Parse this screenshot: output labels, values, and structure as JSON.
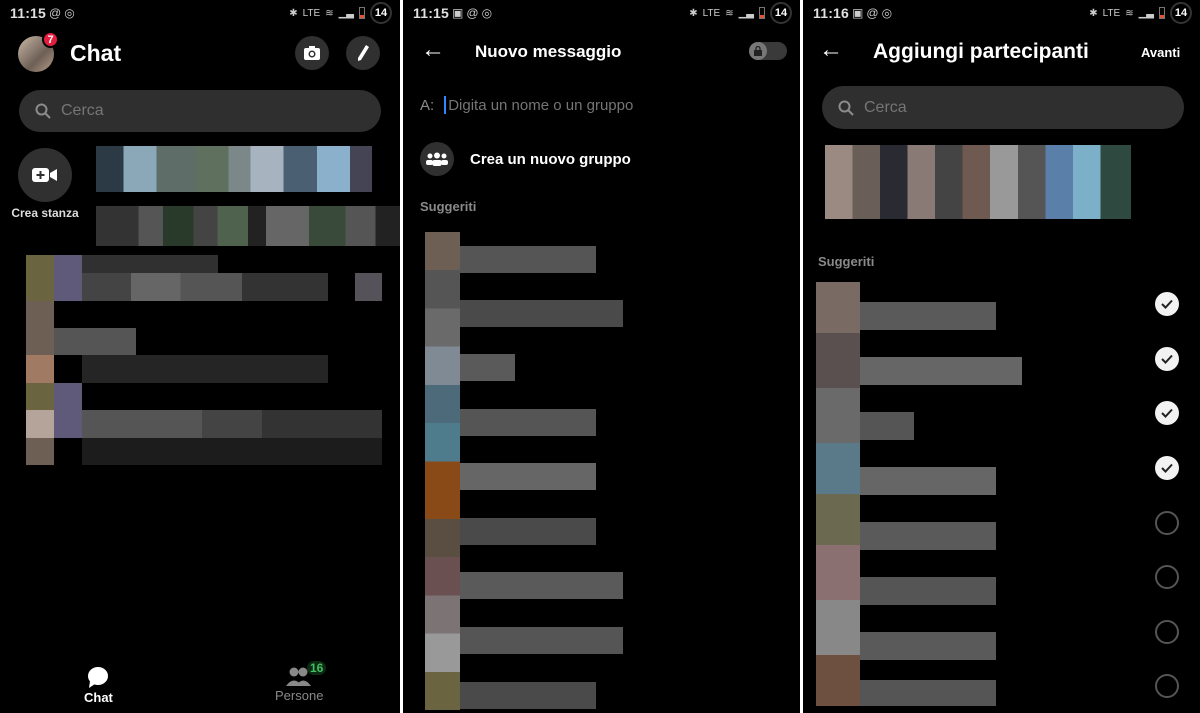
{
  "screens": [
    {
      "status": {
        "time": "11:15",
        "icons": [
          "at-sign-icon",
          "messenger-icon"
        ],
        "battery_badge": "14"
      },
      "header": {
        "title": "Chat",
        "notification_count": "7",
        "camera_icon": "camera-icon",
        "compose_icon": "pencil-icon"
      },
      "search": {
        "placeholder": "Cerca"
      },
      "rooms": {
        "create_room_label": "Crea stanza"
      },
      "bottom_nav": [
        {
          "label": "Chat",
          "icon": "chat-bubble-icon",
          "active": true
        },
        {
          "label": "Persone",
          "icon": "people-icon",
          "badge": "16",
          "active": false
        }
      ]
    },
    {
      "status": {
        "time": "11:15",
        "icons": [
          "image-icon",
          "at-sign-icon",
          "messenger-icon"
        ],
        "battery_badge": "14"
      },
      "header": {
        "title": "Nuovo messaggio",
        "back_icon": "arrow-left-icon",
        "secret_toggle_icon": "lock-icon"
      },
      "to_field": {
        "label": "A:",
        "placeholder": "Digita un nome o un gruppo",
        "value": ""
      },
      "create_group": {
        "label": "Crea un nuovo gruppo",
        "icon": "group-icon"
      },
      "suggested_section": "Suggeriti"
    },
    {
      "status": {
        "time": "11:16",
        "icons": [
          "image-icon",
          "at-sign-icon",
          "messenger-icon"
        ],
        "battery_badge": "14"
      },
      "header": {
        "title": "Aggiungi partecipanti",
        "back_icon": "arrow-left-icon",
        "next_label": "Avanti"
      },
      "search": {
        "placeholder": "Cerca"
      },
      "suggested_section": "Suggeriti",
      "participants_selected": [
        true,
        true,
        true,
        true,
        false,
        false,
        false,
        false
      ]
    }
  ]
}
